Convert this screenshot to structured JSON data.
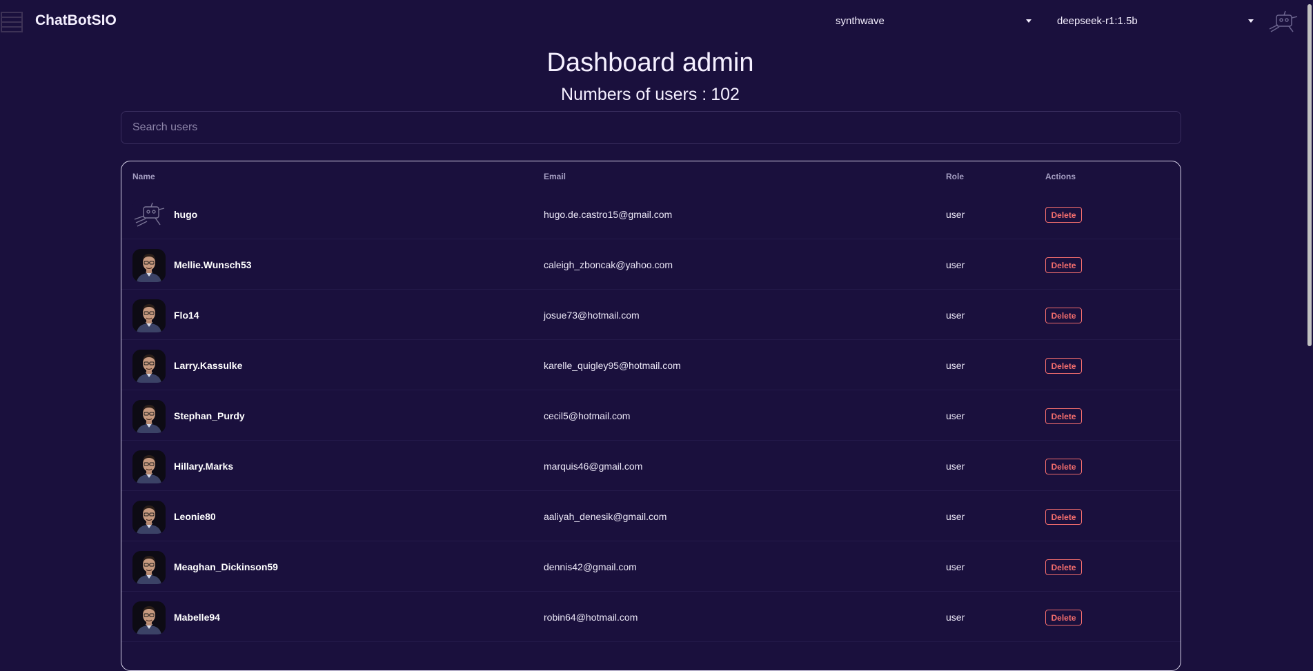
{
  "app": {
    "brand": "ChatBotSIO",
    "theme_select": "synthwave",
    "model_select": "deepseek-r1:1.5b"
  },
  "header": {
    "title": "Dashboard admin",
    "user_count_label": "Numbers of users :",
    "user_count": "102"
  },
  "search": {
    "placeholder": "Search users"
  },
  "table": {
    "columns": [
      "Name",
      "Email",
      "Role",
      "Actions"
    ],
    "delete_label": "Delete",
    "rows": [
      {
        "name": "hugo",
        "email": "hugo.de.castro15@gmail.com",
        "role": "user",
        "avatar": "robot-sketch"
      },
      {
        "name": "Mellie.Wunsch53",
        "email": "caleigh_zboncak@yahoo.com",
        "role": "user",
        "avatar": "man-photo"
      },
      {
        "name": "Flo14",
        "email": "josue73@hotmail.com",
        "role": "user",
        "avatar": "man-photo"
      },
      {
        "name": "Larry.Kassulke",
        "email": "karelle_quigley95@hotmail.com",
        "role": "user",
        "avatar": "man-photo"
      },
      {
        "name": "Stephan_Purdy",
        "email": "cecil5@hotmail.com",
        "role": "user",
        "avatar": "man-photo"
      },
      {
        "name": "Hillary.Marks",
        "email": "marquis46@gmail.com",
        "role": "user",
        "avatar": "man-photo"
      },
      {
        "name": "Leonie80",
        "email": "aaliyah_denesik@gmail.com",
        "role": "user",
        "avatar": "man-photo"
      },
      {
        "name": "Meaghan_Dickinson59",
        "email": "dennis42@gmail.com",
        "role": "user",
        "avatar": "man-photo"
      },
      {
        "name": "Mabelle94",
        "email": "robin64@hotmail.com",
        "role": "user",
        "avatar": "man-photo"
      }
    ]
  },
  "colors": {
    "background": "#1a103d",
    "danger": "#f26d6d",
    "text": "#f5f0ff",
    "muted": "#a59ec2"
  }
}
